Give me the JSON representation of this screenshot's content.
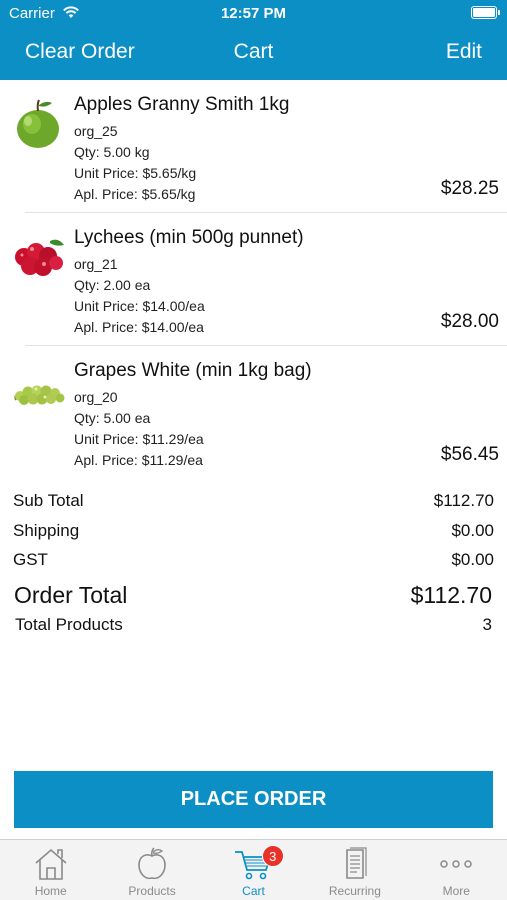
{
  "status": {
    "carrier": "Carrier",
    "time": "12:57 PM"
  },
  "nav": {
    "left": "Clear Order",
    "title": "Cart",
    "right": "Edit"
  },
  "items": [
    {
      "name": "Apples Granny Smith 1kg",
      "code": "org_25",
      "qty": "Qty: 5.00 kg",
      "unit_price": "Unit Price: $5.65/kg",
      "apl_price": "Apl. Price: $5.65/kg",
      "total": "$28.25",
      "icon": "apple-icon"
    },
    {
      "name": "Lychees (min 500g punnet)",
      "code": "org_21",
      "qty": "Qty: 2.00 ea",
      "unit_price": "Unit Price: $14.00/ea",
      "apl_price": "Apl. Price: $14.00/ea",
      "total": "$28.00",
      "icon": "lychee-icon"
    },
    {
      "name": "Grapes White (min 1kg bag)",
      "code": "org_20",
      "qty": "Qty: 5.00 ea",
      "unit_price": "Unit Price: $11.29/ea",
      "apl_price": "Apl. Price: $11.29/ea",
      "total": "$56.45",
      "icon": "grapes-icon"
    }
  ],
  "summary": {
    "subtotal_label": "Sub Total",
    "subtotal": "$112.70",
    "shipping_label": "Shipping",
    "shipping": "$0.00",
    "gst_label": "GST",
    "gst": "$0.00",
    "order_total_label": "Order Total",
    "order_total": "$112.70",
    "total_products_label": "Total Products",
    "total_products": "3"
  },
  "place_order_label": "PLACE ORDER",
  "tabs": [
    {
      "label": "Home",
      "icon": "home-icon"
    },
    {
      "label": "Products",
      "icon": "apple-outline-icon"
    },
    {
      "label": "Cart",
      "icon": "cart-icon",
      "badge": "3",
      "active": true
    },
    {
      "label": "Recurring",
      "icon": "document-icon"
    },
    {
      "label": "More",
      "icon": "more-icon"
    }
  ],
  "colors": {
    "accent": "#0c8fc4",
    "badge": "#e8322a",
    "tab_inactive": "#8a8a8a"
  }
}
